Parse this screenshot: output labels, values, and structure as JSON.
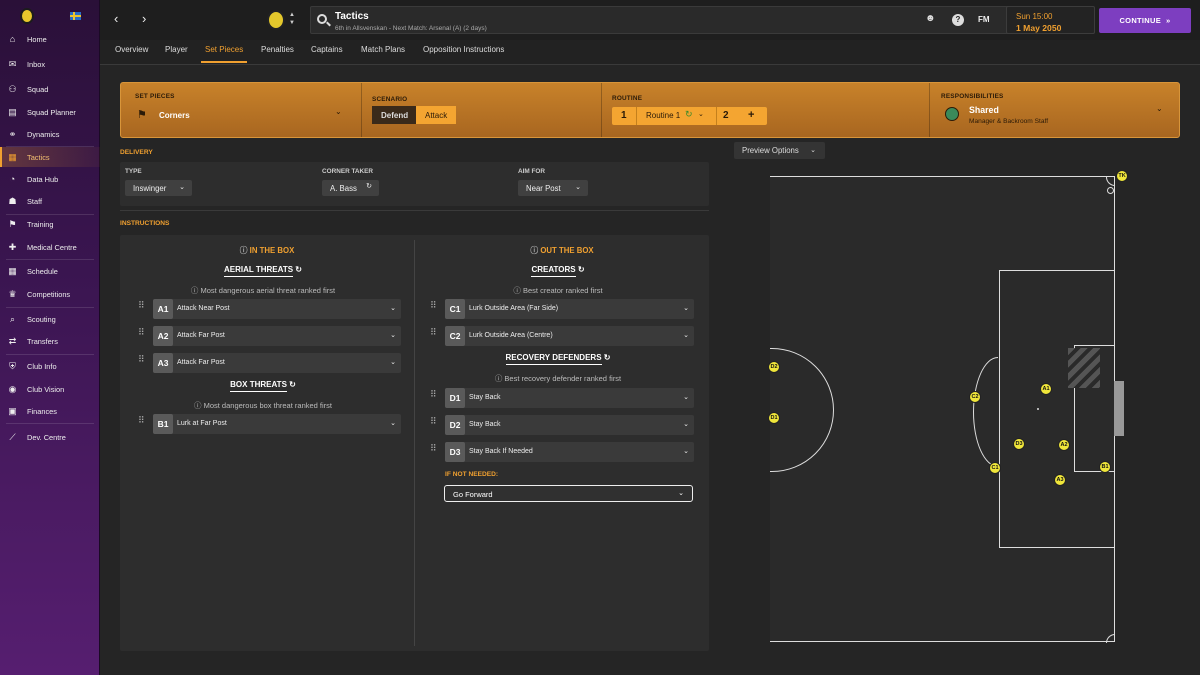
{
  "sidebar": {
    "items": [
      {
        "label": "Home",
        "icon": "home-icon"
      },
      {
        "label": "Inbox",
        "icon": "inbox-icon"
      },
      {
        "label": "Squad",
        "icon": "squad-icon"
      },
      {
        "label": "Squad Planner",
        "icon": "squad-planner-icon"
      },
      {
        "label": "Dynamics",
        "icon": "dynamics-icon"
      },
      {
        "label": "Tactics",
        "icon": "tactics-icon"
      },
      {
        "label": "Data Hub",
        "icon": "data-hub-icon"
      },
      {
        "label": "Staff",
        "icon": "staff-icon"
      },
      {
        "label": "Training",
        "icon": "training-icon"
      },
      {
        "label": "Medical Centre",
        "icon": "medical-icon"
      },
      {
        "label": "Schedule",
        "icon": "schedule-icon"
      },
      {
        "label": "Competitions",
        "icon": "trophy-icon"
      },
      {
        "label": "Scouting",
        "icon": "scouting-icon"
      },
      {
        "label": "Transfers",
        "icon": "transfers-icon"
      },
      {
        "label": "Club Info",
        "icon": "club-info-icon"
      },
      {
        "label": "Club Vision",
        "icon": "club-vision-icon"
      },
      {
        "label": "Finances",
        "icon": "finances-icon"
      },
      {
        "label": "Dev. Centre",
        "icon": "dev-centre-icon"
      }
    ],
    "active": "Tactics"
  },
  "header": {
    "title": "Tactics",
    "subtitle": "6th in Allsvenskan - Next Match: Arsenal (A) (2 days)",
    "fm_label": "FM",
    "date_line1": "Sun 15:00",
    "date_line2": "1 May 2050",
    "continue_label": "CONTINUE"
  },
  "tabs": [
    "Overview",
    "Player",
    "Set Pieces",
    "Penalties",
    "Captains",
    "Match Plans",
    "Opposition Instructions"
  ],
  "active_tab": "Set Pieces",
  "setpieces": {
    "label": "SET PIECES",
    "value": "Corners",
    "scenario_label": "SCENARIO",
    "scenario_options": [
      "Defend",
      "Attack"
    ],
    "scenario_selected": "Attack",
    "routine_label": "ROUTINE",
    "routine_num1": "1",
    "routine_name": "Routine 1",
    "routine_num2": "2",
    "routine_add": "+",
    "resp_label": "RESPONSIBILITIES",
    "resp_value": "Shared",
    "resp_sub": "Manager & Backroom Staff"
  },
  "delivery": {
    "section_title": "DELIVERY",
    "type_label": "TYPE",
    "type_value": "Inswinger",
    "taker_label": "CORNER TAKER",
    "taker_value": "A. Bass",
    "aim_label": "AIM FOR",
    "aim_value": "Near Post"
  },
  "instructions": {
    "section_title": "INSTRUCTIONS",
    "in_box": "IN THE BOX",
    "out_box": "OUT THE BOX",
    "aerial": {
      "title": "AERIAL THREATS",
      "sub": "Most dangerous aerial threat ranked first",
      "rows": [
        {
          "id": "A1",
          "label": "Attack Near Post"
        },
        {
          "id": "A2",
          "label": "Attack Far Post"
        },
        {
          "id": "A3",
          "label": "Attack Far Post"
        }
      ]
    },
    "box": {
      "title": "BOX THREATS",
      "sub": "Most dangerous box threat ranked first",
      "rows": [
        {
          "id": "B1",
          "label": "Lurk at Far Post"
        }
      ]
    },
    "creators": {
      "title": "CREATORS",
      "sub": "Best creator ranked first",
      "rows": [
        {
          "id": "C1",
          "label": "Lurk Outside Area (Far Side)"
        },
        {
          "id": "C2",
          "label": "Lurk Outside Area (Centre)"
        }
      ]
    },
    "recovery": {
      "title": "RECOVERY DEFENDERS",
      "sub": "Best recovery defender ranked first",
      "rows": [
        {
          "id": "D1",
          "label": "Stay Back"
        },
        {
          "id": "D2",
          "label": "Stay Back"
        },
        {
          "id": "D3",
          "label": "Stay Back If Needed"
        }
      ]
    },
    "if_not_needed_label": "IF NOT NEEDED:",
    "if_not_needed_value": "Go Forward"
  },
  "preview_label": "Preview Options",
  "pitch_players": [
    "TK",
    "D2",
    "D1",
    "C2",
    "A1",
    "D3",
    "A2",
    "C1",
    "B1",
    "A3"
  ],
  "colors": {
    "accent": "#f0a030",
    "continue": "#7d3ec0",
    "player_marker": "#f0e63a"
  }
}
